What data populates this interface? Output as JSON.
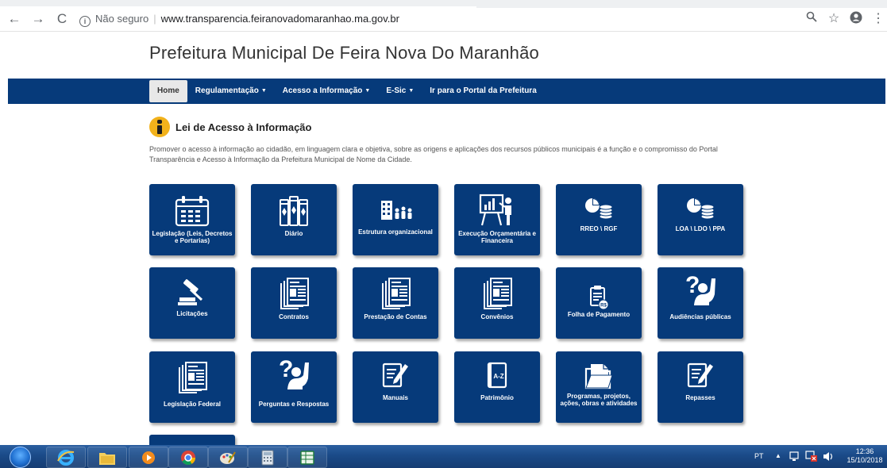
{
  "browser": {
    "secure_label": "Não seguro",
    "url": "www.transparencia.feiranovadomaranhao.ma.gov.br"
  },
  "site": {
    "title": "Prefeitura Municipal De Feira Nova Do Maranhão"
  },
  "menu": {
    "home": "Home",
    "regulamentacao": "Regulamentação",
    "acesso": "Acesso a Informação",
    "esic": "E-Sic",
    "portal": "Ir para o Portal da Prefeitura"
  },
  "intro": {
    "title": "Lei de Acesso à Informação",
    "text": "Promover o acesso à informação ao cidadão, em linguagem clara e objetiva, sobre as origens e aplicações dos recursos públicos municipais é a função e o compromisso do Portal Transparência e Acesso à Informação da Prefeitura Municipal de Nome da Cidade."
  },
  "tiles": [
    {
      "label": "Legislação (Leis, Decretos e Portarias)",
      "icon": "calendar-icon"
    },
    {
      "label": "Diário",
      "icon": "books-icon"
    },
    {
      "label": "Estrutura organizacional",
      "icon": "organization-icon"
    },
    {
      "label": "Execução Orçamentária e Financeira",
      "icon": "presentation-icon"
    },
    {
      "label": "RREO \\ RGF",
      "icon": "coins-chart-icon"
    },
    {
      "label": "LOA \\ LDO \\ PPA",
      "icon": "coins-chart-icon"
    },
    {
      "label": "Licitações",
      "icon": "gavel-icon"
    },
    {
      "label": "Contratos",
      "icon": "documents-icon"
    },
    {
      "label": "Prestação de Contas",
      "icon": "documents-icon"
    },
    {
      "label": "Convênios",
      "icon": "documents-icon"
    },
    {
      "label": "Folha de Pagamento",
      "icon": "clipboard-money-icon"
    },
    {
      "label": "Audiências públicas",
      "icon": "question-person-icon"
    },
    {
      "label": "Legislação Federal",
      "icon": "documents-icon"
    },
    {
      "label": "Perguntas e Respostas",
      "icon": "question-person-icon"
    },
    {
      "label": "Manuais",
      "icon": "edit-document-icon"
    },
    {
      "label": "Patrimônio",
      "icon": "book-az-icon"
    },
    {
      "label": "Programas, projetos, ações, obras e atividades",
      "icon": "folder-icon"
    },
    {
      "label": "Repasses",
      "icon": "edit-document-icon"
    }
  ],
  "tile_texts": {
    "patrimonio_book": "A-Z",
    "folha_badge": "R$"
  },
  "taskbar": {
    "language": "PT",
    "time": "12:36",
    "date": "15/10/2018"
  }
}
